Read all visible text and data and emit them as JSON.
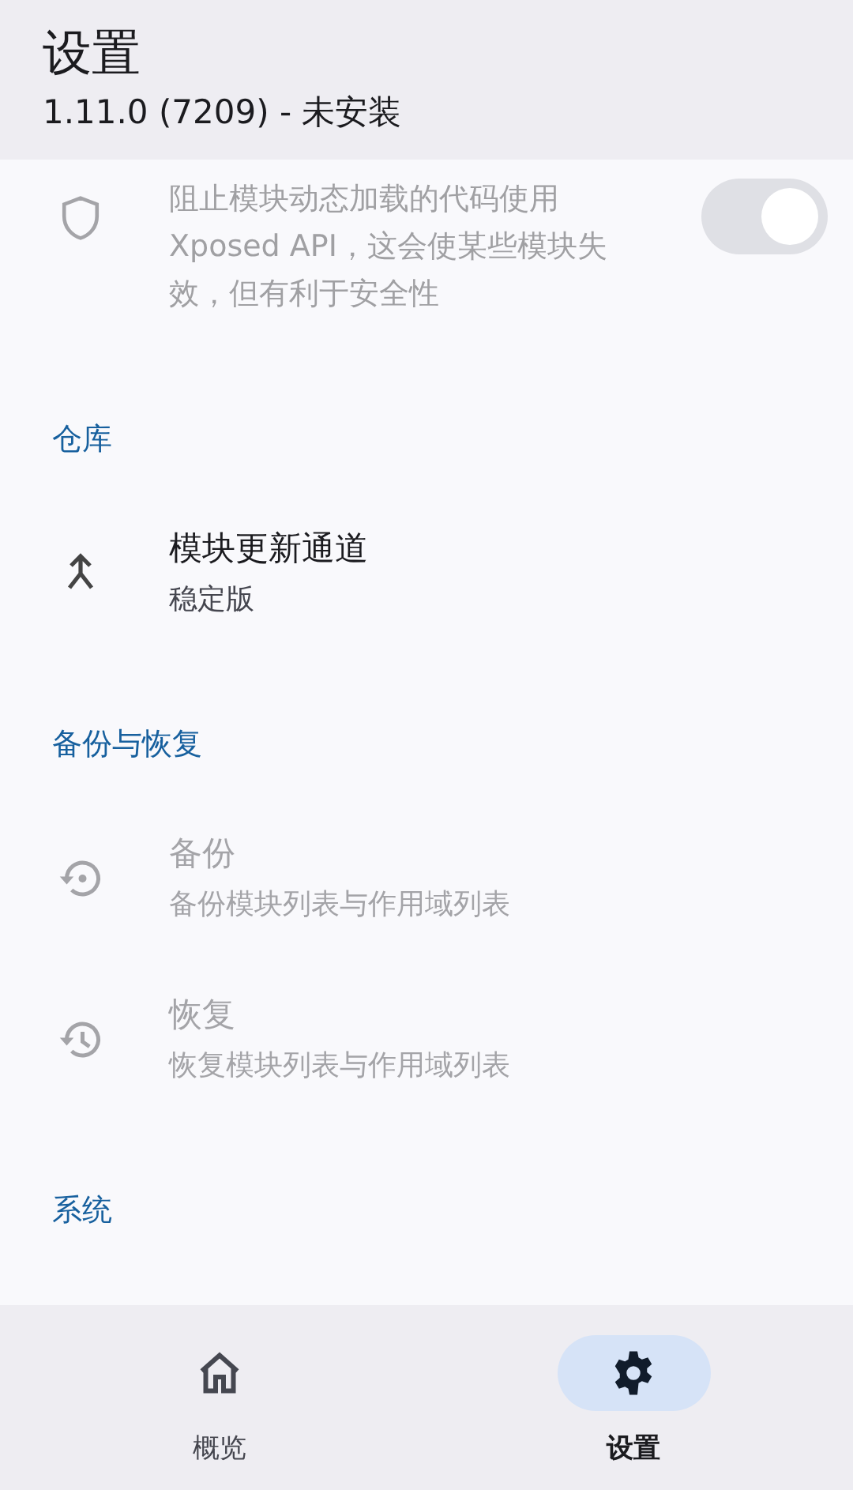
{
  "app_bar": {
    "title": "设置",
    "subtitle": "1.11.0 (7209) - 未安装"
  },
  "list": [
    {
      "kind": "switch",
      "description": "阻止模块动态加载的代码使用 Xposed API，这会使某些模块失效，但有利于安全性",
      "checked": true,
      "disabled": true
    },
    {
      "kind": "section",
      "title": "仓库"
    },
    {
      "kind": "item",
      "title": "模块更新通道",
      "subtitle": "稳定版",
      "disabled": false
    },
    {
      "kind": "section",
      "title": "备份与恢复"
    },
    {
      "kind": "item",
      "title": "备份",
      "subtitle": "备份模块列表与作用域列表",
      "disabled": true
    },
    {
      "kind": "item",
      "title": "恢复",
      "subtitle": "恢复模块列表与作用域列表",
      "disabled": true
    },
    {
      "kind": "section",
      "title": "系统"
    }
  ],
  "bottom_nav": [
    {
      "label": "概览",
      "selected": false
    },
    {
      "label": "设置",
      "selected": true
    }
  ]
}
